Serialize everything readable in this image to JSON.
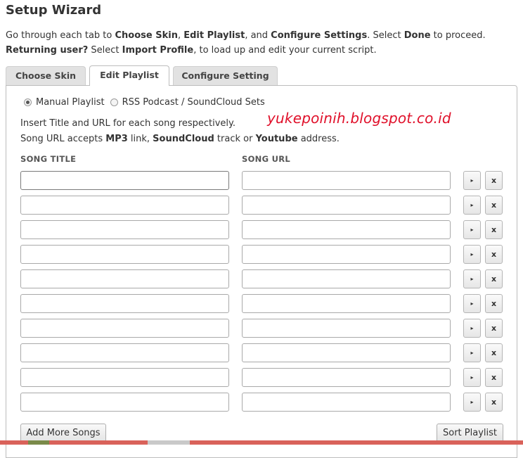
{
  "header": {
    "title": "Setup Wizard"
  },
  "intro": {
    "l1_a": "Go through each tab to ",
    "l1_b": "Choose Skin",
    "l1_c": ", ",
    "l1_d": "Edit Playlist",
    "l1_e": ", and ",
    "l1_f": "Configure Settings",
    "l1_g": ". Select ",
    "l1_h": "Done",
    "l1_i": " to proceed.",
    "l2_a": "Returning user?",
    "l2_b": " Select ",
    "l2_c": "Import Profile",
    "l2_d": ", to load up and edit your current script."
  },
  "tabs": [
    {
      "label": "Choose Skin",
      "active": false
    },
    {
      "label": "Edit Playlist",
      "active": true
    },
    {
      "label": "Configure Setting",
      "active": false
    }
  ],
  "source": {
    "manual_label": "Manual Playlist",
    "rss_label": "RSS Podcast / SoundCloud Sets",
    "selected": "Manual Playlist"
  },
  "help": {
    "line1": "Insert Title and URL for each song respectively.",
    "l2_a": "Song URL accepts ",
    "l2_b": "MP3",
    "l2_c": " link, ",
    "l2_d": "SoundCloud",
    "l2_e": " track or ",
    "l2_f": "Youtube",
    "l2_g": " address."
  },
  "watermark": "yukepoinih.blogspot.co.id",
  "columns": {
    "title": "SONG TITLE",
    "url": "SONG URL"
  },
  "rows": [
    {
      "title": "",
      "url": ""
    },
    {
      "title": "",
      "url": ""
    },
    {
      "title": "",
      "url": ""
    },
    {
      "title": "",
      "url": ""
    },
    {
      "title": "",
      "url": ""
    },
    {
      "title": "",
      "url": ""
    },
    {
      "title": "",
      "url": ""
    },
    {
      "title": "",
      "url": ""
    },
    {
      "title": "",
      "url": ""
    },
    {
      "title": "",
      "url": ""
    }
  ],
  "row_buttons": {
    "play_label": "▸",
    "delete_label": "x",
    "play_icon": "play-icon",
    "delete_icon": "close-icon"
  },
  "actions": {
    "add_more": "Add More Songs",
    "sort": "Sort Playlist"
  },
  "colors": {
    "watermark": "#e0102a",
    "tab_inactive": "#e2e2e2",
    "border": "#bdbdbd"
  }
}
